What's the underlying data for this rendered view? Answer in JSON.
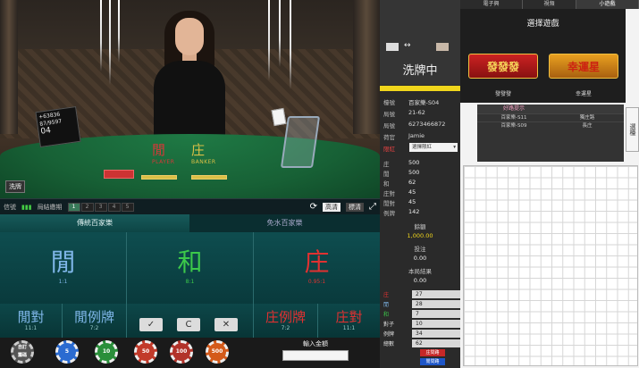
{
  "video": {
    "felt_player": "閒",
    "felt_player_sub": "PLAYER",
    "felt_banker": "庄",
    "felt_banker_sub": "BANKER",
    "scoreboard_line1": "+63836",
    "scoreboard_line2": "87/9597",
    "scoreboard_num": "04",
    "shuffle_btn": "洗牌"
  },
  "toolbar": {
    "signal_label": "信號",
    "history_label": "局結繳期",
    "segments": [
      "1",
      "2",
      "3",
      "4",
      "5"
    ],
    "mode_a": "高清",
    "mode_b": "標清"
  },
  "bet": {
    "tab_traditional": "傳統百家樂",
    "tab_free": "免水百家樂",
    "player": "閒",
    "player_odds": "1:1",
    "tie": "和",
    "tie_odds": "8:1",
    "banker": "庄",
    "banker_odds": "0.95:1",
    "player_pair": "閒對",
    "player_pair_odds": "11:1",
    "player_ratio": "閒例牌",
    "player_ratio_odds": "7:2",
    "banker_ratio": "庄例牌",
    "banker_ratio_odds": "7:2",
    "banker_pair": "庄對",
    "banker_pair_odds": "11:1",
    "confirm_icon": "✓",
    "repeat_icon": "C",
    "cancel_icon": "✕",
    "input_label": "輸入金額"
  },
  "chips": [
    {
      "label": "自訂\n籌碼",
      "color": "#555555"
    },
    {
      "label": "5",
      "color": "#2a6bd1"
    },
    {
      "label": "10",
      "color": "#2a8f3a"
    },
    {
      "label": "50",
      "color": "#c23a2a"
    },
    {
      "label": "100",
      "color": "#b2332a"
    },
    {
      "label": "500",
      "color": "#d45a1a"
    }
  ],
  "mid": {
    "shuffling": "洗牌中",
    "info": [
      {
        "k": "檯號",
        "v": "百家樂-S04"
      },
      {
        "k": "局號",
        "v": "21-62"
      },
      {
        "k": "局號",
        "v": "6273466872"
      },
      {
        "k": "荷官",
        "v": "Jamie"
      }
    ],
    "limit_label": "限紅",
    "limit_value": "選擇限紅",
    "stats": [
      {
        "k": "庄",
        "v": "500"
      },
      {
        "k": "閒",
        "v": "500"
      },
      {
        "k": "和",
        "v": "62"
      },
      {
        "k": "庄對",
        "v": "45"
      },
      {
        "k": "閒對",
        "v": "45"
      },
      {
        "k": "例牌",
        "v": "142"
      }
    ],
    "balance_label": "餘額",
    "balance_value": "1,000.00",
    "bet_label": "投注",
    "bet_value": "0.00",
    "result_label": "本局結果",
    "result_value": "0.00",
    "counts": [
      {
        "k": "庄",
        "v": "27"
      },
      {
        "k": "閒",
        "v": "28"
      },
      {
        "k": "和",
        "v": "7"
      },
      {
        "k": "對子",
        "v": "10"
      },
      {
        "k": "例牌",
        "v": "34"
      },
      {
        "k": "總數",
        "v": "62"
      }
    ],
    "btn_a": "庄問路",
    "btn_b": "閒問路"
  },
  "right": {
    "tabs": [
      "電子興",
      "視頻",
      "小遊戲"
    ],
    "select_title": "選擇遊戲",
    "games": [
      {
        "title": "發發發",
        "name": "發發發"
      },
      {
        "title": "幸運星",
        "name": "幸運星"
      }
    ],
    "side_tab": "選檯",
    "fav_title": "好路提示",
    "fav_rows": [
      {
        "a": "百家樂-S11",
        "b": "獨庄路"
      },
      {
        "a": "百家樂-S09",
        "b": "長庄"
      }
    ]
  },
  "colors": {
    "banker_red": "#e03131",
    "player_blue": "#7fb6e8",
    "tie_green": "#3cc94a",
    "highlight_yellow": "#f1d61c"
  }
}
